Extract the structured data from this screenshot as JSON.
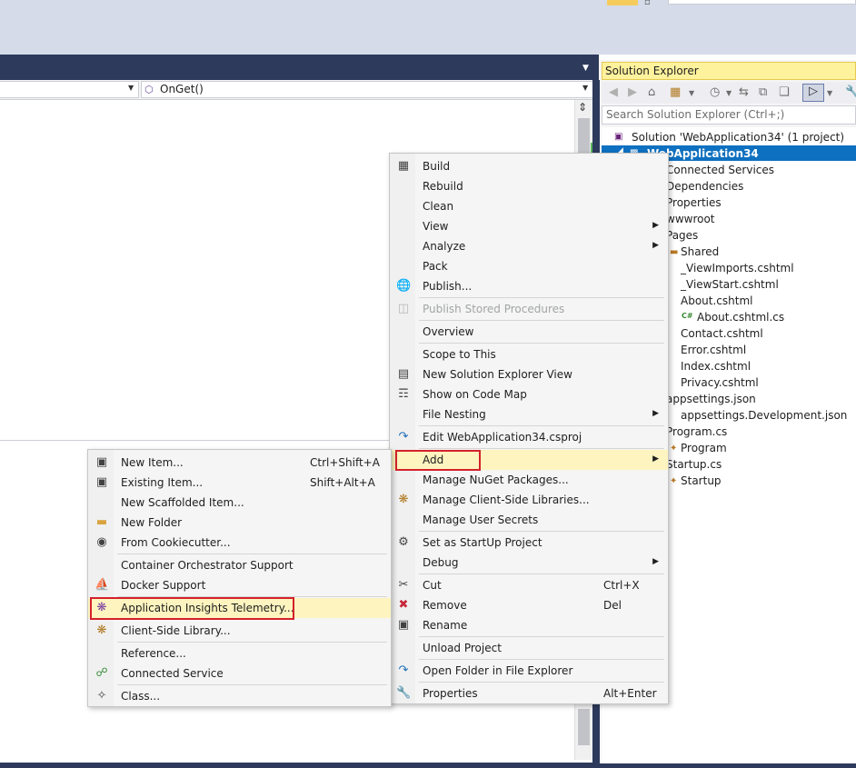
{
  "editor": {
    "nav_member": "OnGet()"
  },
  "solution_explorer": {
    "title": "Solution Explorer",
    "search_placeholder": "Search Solution Explorer (Ctrl+;)",
    "tree": [
      {
        "label": "Solution 'WebApplication34' (1 project)",
        "icon": "solution-icon"
      },
      {
        "label": "WebApplication34",
        "icon": "csharp-project-icon",
        "selected": true
      },
      {
        "label": "Connected Services",
        "icon": "connected-services-icon"
      },
      {
        "label": "Dependencies",
        "icon": "dependencies-icon"
      },
      {
        "label": "Properties",
        "icon": "properties-icon"
      },
      {
        "label": "wwwroot",
        "icon": "globe-folder-icon"
      },
      {
        "label": "Pages",
        "icon": "folder-icon"
      },
      {
        "label": "Shared",
        "icon": "folder-icon"
      },
      {
        "label": "_ViewImports.cshtml",
        "icon": "razor-file-icon"
      },
      {
        "label": "_ViewStart.cshtml",
        "icon": "razor-file-icon"
      },
      {
        "label": "About.cshtml",
        "icon": "razor-file-icon"
      },
      {
        "label": "About.cshtml.cs",
        "icon": "csharp-file-icon"
      },
      {
        "label": "Contact.cshtml",
        "icon": "razor-file-icon"
      },
      {
        "label": "Error.cshtml",
        "icon": "razor-file-icon"
      },
      {
        "label": "Index.cshtml",
        "icon": "razor-file-icon"
      },
      {
        "label": "Privacy.cshtml",
        "icon": "razor-file-icon"
      },
      {
        "label": "appsettings.json",
        "icon": "json-file-icon"
      },
      {
        "label": "appsettings.Development.json",
        "icon": "json-file-icon"
      },
      {
        "label": "Program.cs",
        "icon": "csharp-file-icon"
      },
      {
        "label": "Program",
        "icon": "class-icon"
      },
      {
        "label": "Startup.cs",
        "icon": "csharp-file-icon"
      },
      {
        "label": "Startup",
        "icon": "class-icon"
      }
    ]
  },
  "project_menu": {
    "items": {
      "build": "Build",
      "rebuild": "Rebuild",
      "clean": "Clean",
      "view": "View",
      "analyze": "Analyze",
      "pack": "Pack",
      "publish": "Publish...",
      "publish_stored_procedures": "Publish Stored Procedures",
      "overview": "Overview",
      "scope_to_this": "Scope to This",
      "new_solution_explorer_view": "New Solution Explorer View",
      "show_on_code_map": "Show on Code Map",
      "file_nesting": "File Nesting",
      "edit_csproj": "Edit WebApplication34.csproj",
      "add": "Add",
      "manage_nuget": "Manage NuGet Packages...",
      "manage_client_libs": "Manage Client-Side Libraries...",
      "manage_user_secrets": "Manage User Secrets",
      "set_startup": "Set as StartUp Project",
      "debug": "Debug",
      "cut": "Cut",
      "cut_shortcut": "Ctrl+X",
      "remove": "Remove",
      "remove_shortcut": "Del",
      "rename": "Rename",
      "unload_project": "Unload Project",
      "open_folder": "Open Folder in File Explorer",
      "properties": "Properties",
      "properties_shortcut": "Alt+Enter"
    }
  },
  "add_menu": {
    "items": {
      "new_item": "New Item...",
      "new_item_shortcut": "Ctrl+Shift+A",
      "existing_item": "Existing Item...",
      "existing_item_shortcut": "Shift+Alt+A",
      "new_scaffolded_item": "New Scaffolded Item...",
      "new_folder": "New Folder",
      "from_cookiecutter": "From Cookiecutter...",
      "container_orchestrator": "Container Orchestrator Support",
      "docker_support": "Docker Support",
      "app_insights": "Application Insights Telemetry...",
      "client_side_library": "Client-Side Library...",
      "reference": "Reference...",
      "connected_service": "Connected Service",
      "class": "Class..."
    }
  },
  "colors": {
    "title_bar": "#2d3a5c",
    "selection": "#0e70c0",
    "highlight_box": "#d4212b",
    "menu_hover": "#fdf4bf"
  }
}
